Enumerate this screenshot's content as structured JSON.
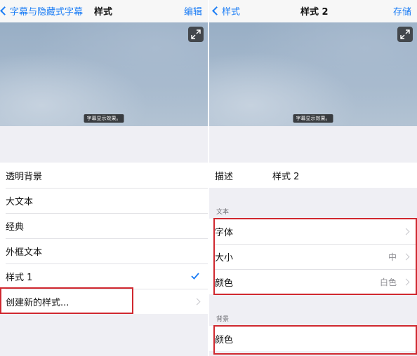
{
  "left": {
    "nav": {
      "back_label": "字幕与隐藏式字幕",
      "title": "样式",
      "action": "编辑"
    },
    "preview": {
      "caption": "字幕显示效果。",
      "expand_icon": "expand-icon"
    },
    "styles": [
      {
        "label": "透明背景",
        "selected": false
      },
      {
        "label": "大文本",
        "selected": false
      },
      {
        "label": "经典",
        "selected": false
      },
      {
        "label": "外框文本",
        "selected": false
      },
      {
        "label": "样式 1",
        "selected": true
      }
    ],
    "create_new": "创建新的样式..."
  },
  "right": {
    "nav": {
      "back_label": "样式",
      "title": "样式 2",
      "action": "存储"
    },
    "preview": {
      "caption": "字幕显示效果。",
      "expand_icon": "expand-icon"
    },
    "description": {
      "label": "描述",
      "value": "样式 2"
    },
    "text_section": {
      "header": "文本",
      "items": [
        {
          "label": "字体",
          "value": ""
        },
        {
          "label": "大小",
          "value": "中"
        },
        {
          "label": "颜色",
          "value": "白色"
        }
      ]
    },
    "background_section": {
      "header": "背景",
      "items": [
        {
          "label": "颜色",
          "value": ""
        }
      ]
    }
  },
  "colors": {
    "accent": "#1a7cf5",
    "highlight": "#d0282f",
    "group_bg": "#efeff4"
  }
}
